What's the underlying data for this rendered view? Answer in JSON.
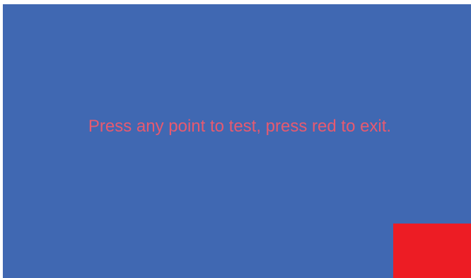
{
  "screen": {
    "instruction": "Press any point to test, press red to exit."
  },
  "colors": {
    "background": "#4068B2",
    "text": "#E75A70",
    "exit": "#ED1C24",
    "frame": "#FFFFFF"
  },
  "exit_button": {
    "label": ""
  }
}
